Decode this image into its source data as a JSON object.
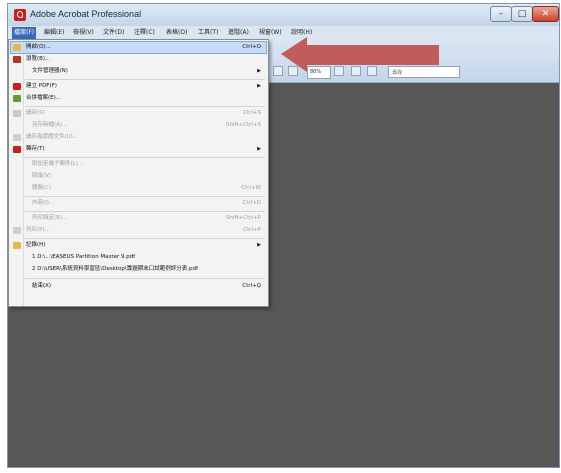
{
  "window": {
    "title": "Adobe Acrobat Professional",
    "min_glyph": "–",
    "max_glyph": "□",
    "close_glyph": "✕"
  },
  "menubar": [
    "檔案(F)",
    "編輯(E)",
    "檢視(V)",
    "文件(D)",
    "注釋(C)",
    "表格(O)",
    "工具(T)",
    "進階(A)",
    "視窗(W)",
    "說明(H)"
  ],
  "toolbar": {
    "zoom_value": "80%",
    "search_value": "尋找"
  },
  "file_menu": {
    "items": [
      {
        "label": "開啟(O)...",
        "shortcut": "Ctrl+O",
        "enabled": true,
        "highlighted": true,
        "icon": "folder-open-icon"
      },
      {
        "label": "瀏覽(B)...",
        "shortcut": "",
        "enabled": true,
        "icon": "organizer-icon"
      },
      {
        "label": "文件管理器(N)",
        "shortcut": "",
        "enabled": true,
        "submenu": true
      },
      {
        "label": "建立 PDF(F)",
        "shortcut": "",
        "enabled": true,
        "submenu": true,
        "icon": "create-pdf-icon"
      },
      {
        "label": "合併檔案(E)...",
        "shortcut": "",
        "enabled": true,
        "icon": "combine-files-icon"
      },
      {
        "label": "儲存(S)",
        "shortcut": "Ctrl+S",
        "enabled": false,
        "icon": "save-icon"
      },
      {
        "label": "另存新檔(A)...",
        "shortcut": "Shift+Ctrl+S",
        "enabled": false
      },
      {
        "label": "儲存為認證文件(U)...",
        "shortcut": "",
        "enabled": false,
        "icon": "certify-icon"
      },
      {
        "label": "轉存(T)",
        "shortcut": "",
        "enabled": true,
        "submenu": true,
        "icon": "export-icon"
      },
      {
        "label": "附加至電子郵件(L)...",
        "shortcut": "",
        "enabled": false
      },
      {
        "label": "回復(V)",
        "shortcut": "",
        "enabled": false
      },
      {
        "label": "關閉(C)",
        "shortcut": "Ctrl+W",
        "enabled": false
      },
      {
        "label": "內容(I)...",
        "shortcut": "Ctrl+D",
        "enabled": false
      },
      {
        "label": "列印設定(R)...",
        "shortcut": "Shift+Ctrl+P",
        "enabled": false
      },
      {
        "label": "列印(P)...",
        "shortcut": "Ctrl+P",
        "enabled": false,
        "icon": "print-icon"
      },
      {
        "label": "記錄(H)",
        "shortcut": "",
        "enabled": true,
        "submenu": true,
        "icon": "history-icon"
      },
      {
        "label": "1 D:\\...\\EASEUS Partition Master 9.pdf",
        "shortcut": "",
        "enabled": true
      },
      {
        "label": "2 D:\\USER\\系統資料學習區\\Desktop\\專題期末口試範例評分表.pdf",
        "shortcut": "",
        "enabled": true
      },
      {
        "label": "結束(X)",
        "shortcut": "Ctrl+Q",
        "enabled": true
      }
    ]
  },
  "colors": {
    "menu_highlight": "#c6dcf5",
    "active_menu": "#3a6ab8",
    "pointer_arrow": "#c0504d",
    "workspace": "#575757"
  }
}
